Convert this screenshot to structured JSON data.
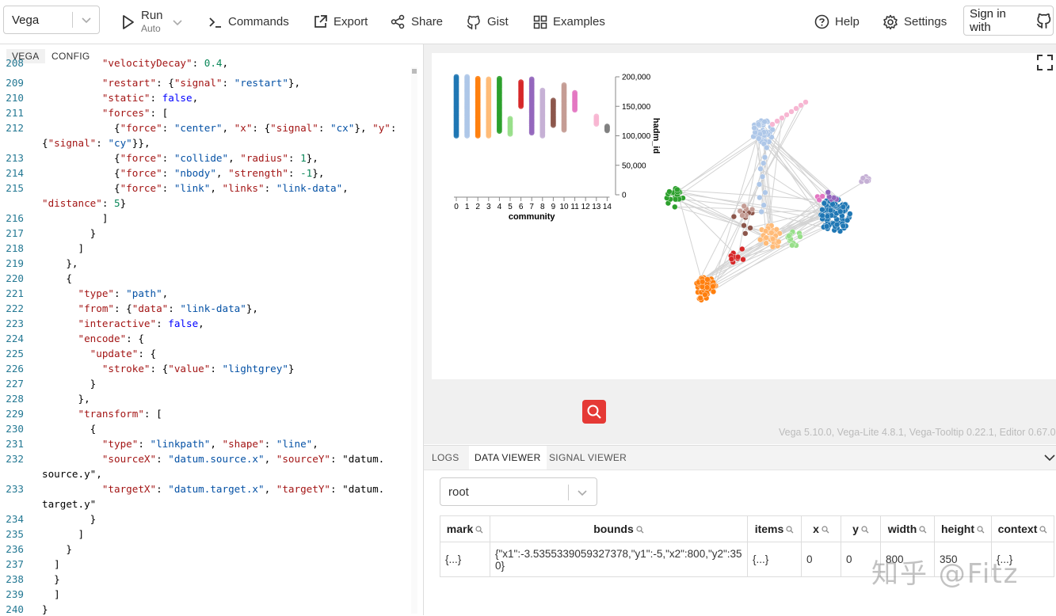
{
  "toolbar": {
    "mode": "Vega",
    "run_label": "Run",
    "run_sub": "Auto",
    "commands": "Commands",
    "export": "Export",
    "share": "Share",
    "gist": "Gist",
    "examples": "Examples",
    "help": "Help",
    "settings": "Settings",
    "signin": "Sign in with"
  },
  "editor": {
    "tabs": [
      "VEGA",
      "CONFIG"
    ],
    "lines": [
      {
        "n": "208",
        "t": "          \"velocityDecay\": 0.4,"
      },
      {
        "n": "209",
        "t": "          \"restart\": {\"signal\": \"restart\"},"
      },
      {
        "n": "210",
        "t": "          \"static\": false,"
      },
      {
        "n": "211",
        "t": "          \"forces\": ["
      },
      {
        "n": "212",
        "t": "            {\"force\": \"center\", \"x\": {\"signal\": \"cx\"}, \"y\":"
      },
      {
        "n": "",
        "t": "{\"signal\": \"cy\"}},"
      },
      {
        "n": "213",
        "t": "            {\"force\": \"collide\", \"radius\": 1},"
      },
      {
        "n": "214",
        "t": "            {\"force\": \"nbody\", \"strength\": -1},"
      },
      {
        "n": "215",
        "t": "            {\"force\": \"link\", \"links\": \"link-data\","
      },
      {
        "n": "",
        "t": "\"distance\": 5}"
      },
      {
        "n": "216",
        "t": "          ]"
      },
      {
        "n": "217",
        "t": "        }"
      },
      {
        "n": "218",
        "t": "      ]"
      },
      {
        "n": "219",
        "t": "    },"
      },
      {
        "n": "220",
        "t": "    {"
      },
      {
        "n": "221",
        "t": "      \"type\": \"path\","
      },
      {
        "n": "222",
        "t": "      \"from\": {\"data\": \"link-data\"},"
      },
      {
        "n": "223",
        "t": "      \"interactive\": false,"
      },
      {
        "n": "224",
        "t": "      \"encode\": {"
      },
      {
        "n": "225",
        "t": "        \"update\": {"
      },
      {
        "n": "226",
        "t": "          \"stroke\": {\"value\": \"lightgrey\"}"
      },
      {
        "n": "227",
        "t": "        }"
      },
      {
        "n": "228",
        "t": "      },"
      },
      {
        "n": "229",
        "t": "      \"transform\": ["
      },
      {
        "n": "230",
        "t": "        {"
      },
      {
        "n": "231",
        "t": "          \"type\": \"linkpath\", \"shape\": \"line\","
      },
      {
        "n": "232",
        "t": "          \"sourceX\": \"datum.source.x\", \"sourceY\": \"datum."
      },
      {
        "n": "",
        "t": "source.y\","
      },
      {
        "n": "233",
        "t": "          \"targetX\": \"datum.target.x\", \"targetY\": \"datum."
      },
      {
        "n": "",
        "t": "target.y\""
      },
      {
        "n": "234",
        "t": "        }"
      },
      {
        "n": "235",
        "t": "      ]"
      },
      {
        "n": "236",
        "t": "    }"
      },
      {
        "n": "237",
        "t": "  ]"
      },
      {
        "n": "238",
        "t": "  }"
      },
      {
        "n": "239",
        "t": "  ]"
      },
      {
        "n": "240",
        "t": "}"
      }
    ]
  },
  "chart_data": {
    "type": "scatter",
    "xlabel": "community",
    "ylabel": "hadm_id",
    "x_ticks": [
      "0",
      "1",
      "2",
      "3",
      "4",
      "5",
      "6",
      "7",
      "8",
      "9",
      "10",
      "11",
      "12",
      "13",
      "14"
    ],
    "y_ticks": [
      "0",
      "50,000",
      "100,000",
      "150,000",
      "200,000"
    ],
    "ylim": [
      0,
      200000
    ],
    "series": [
      {
        "community": 0,
        "color": "#1f77b4",
        "min": 100000,
        "max": 200000
      },
      {
        "community": 1,
        "color": "#aec7e8",
        "min": 100000,
        "max": 200000
      },
      {
        "community": 2,
        "color": "#ff7f0e",
        "min": 100000,
        "max": 197000
      },
      {
        "community": 3,
        "color": "#ffbb78",
        "min": 100000,
        "max": 196000
      },
      {
        "community": 4,
        "color": "#2ca02c",
        "min": 108000,
        "max": 197000
      },
      {
        "community": 5,
        "color": "#98df8a",
        "min": 103000,
        "max": 129000
      },
      {
        "community": 6,
        "color": "#d62728",
        "min": 150000,
        "max": 191000
      },
      {
        "community": 7,
        "color": "#9467bd",
        "min": 105000,
        "max": 196000
      },
      {
        "community": 8,
        "color": "#c5b0d5",
        "min": 100000,
        "max": 177000
      },
      {
        "community": 9,
        "color": "#8c564b",
        "min": 118000,
        "max": 160000
      },
      {
        "community": 10,
        "color": "#c49c94",
        "min": 110000,
        "max": 186000
      },
      {
        "community": 11,
        "color": "#e377c2",
        "min": 144000,
        "max": 173000
      },
      {
        "community": 13,
        "color": "#f7b6d2",
        "min": 120000,
        "max": 133000
      },
      {
        "community": 14,
        "color": "#7f7f7f",
        "min": 109000,
        "max": 116000
      }
    ]
  },
  "viz": {
    "version": "Vega 5.10.0, Vega-Lite 4.8.1, Vega-Tooltip 0.22.1, Editor 0.67.0"
  },
  "bottom": {
    "tabs": [
      "LOGS",
      "DATA VIEWER",
      "SIGNAL VIEWER"
    ],
    "dataset": "root",
    "columns": [
      "mark",
      "bounds",
      "items",
      "x",
      "y",
      "width",
      "height",
      "context"
    ],
    "row": [
      "{...}",
      "{\"x1\":-3.5355339059327378,\"y1\":-5,\"x2\":800,\"y2\":350}",
      "{...}",
      "0",
      "0",
      "800",
      "350",
      "{...}"
    ]
  },
  "watermark": "知乎 @Fitz"
}
